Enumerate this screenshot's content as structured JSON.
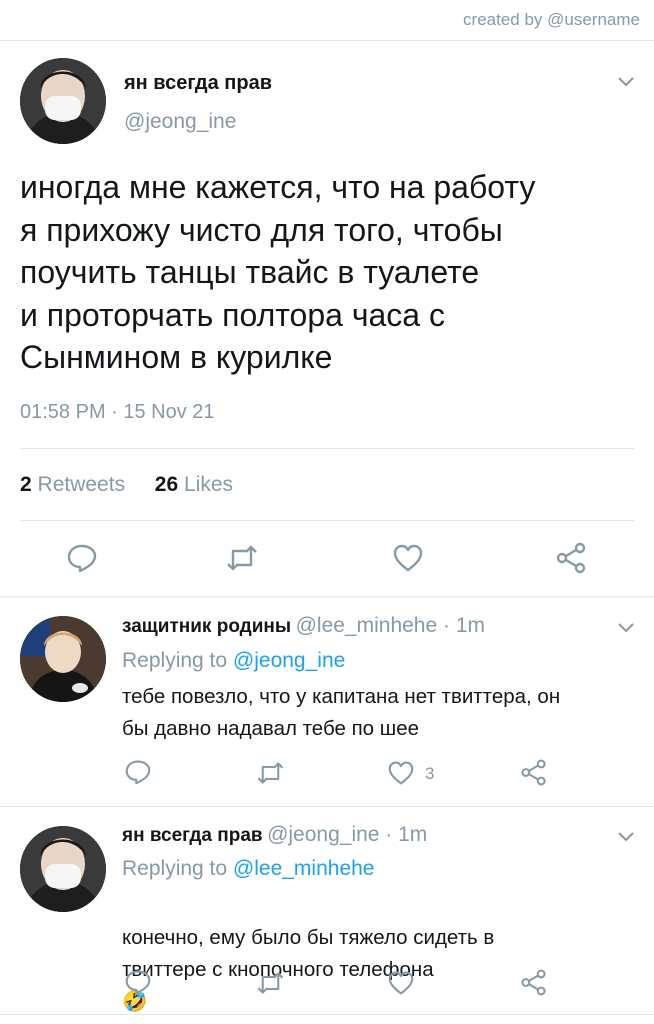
{
  "credit": "created by @username",
  "tweet": {
    "author_name": "ян всегда прав",
    "author_handle": "@jeong_ine",
    "text": "иногда мне кажется, что на работу\nя прихожу чисто для того, чтобы\nпоучить танцы твайс в туалете\nи проторчать полтора часа с\nСынмином в курилке",
    "time": "01:58 PM · 15 Nov 21",
    "retweets_count": "2",
    "retweets_label": "Retweets",
    "likes_count": "26",
    "likes_label": "Likes"
  },
  "replies": [
    {
      "author_name": "защитник родины",
      "meta": "@lee_minhehe · 1m",
      "replying_prefix": "Replying to",
      "replying_to": "@jeong_ine",
      "text": "тебе повезло, что у капитана нет твиттера, он\nбы давно надавал тебе по шее",
      "like_count": "3"
    },
    {
      "author_name": "ян всегда прав",
      "meta": "@jeong_ine · 1m",
      "replying_prefix": "Replying to",
      "replying_to": "@lee_minhehe",
      "text": "конечно, ему было бы тяжело сидеть в\nтвиттере с кнопочного телефона",
      "emoji": "🤣"
    }
  ],
  "colors": {
    "gray": "#8899a6",
    "link": "#1da1f2",
    "text": "#14171a",
    "separator": "#e1e8ed"
  },
  "icons": [
    "reply-icon",
    "retweet-icon",
    "like-icon",
    "share-icon",
    "chevron-down-icon"
  ]
}
